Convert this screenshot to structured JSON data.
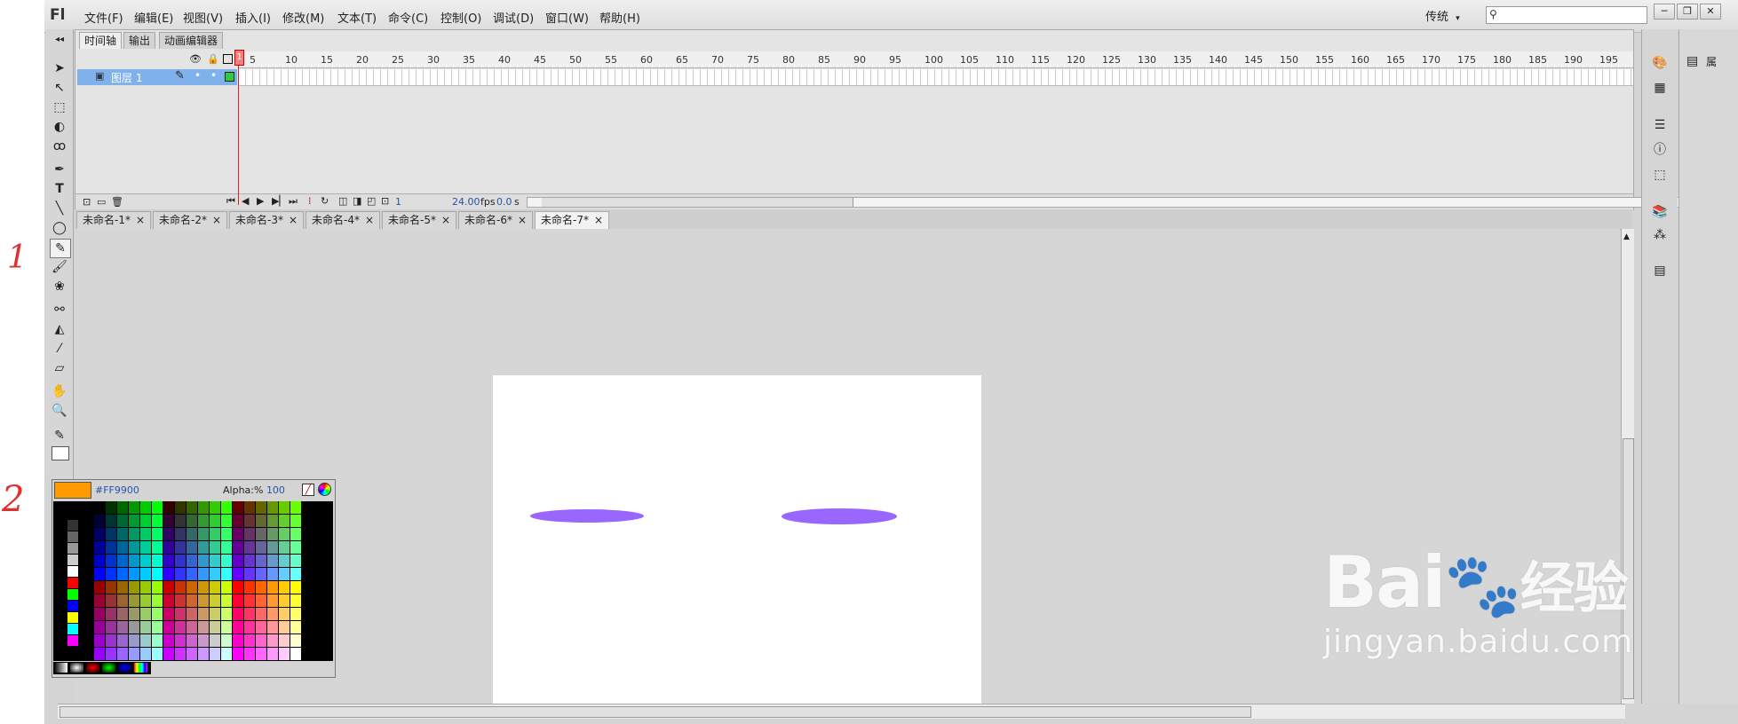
{
  "app": {
    "logo": "Fl"
  },
  "menu": [
    "文件(F)",
    "编辑(E)",
    "视图(V)",
    "插入(I)",
    "修改(M)",
    "文本(T)",
    "命令(C)",
    "控制(O)",
    "调试(D)",
    "窗口(W)",
    "帮助(H)"
  ],
  "workspace": {
    "label": "传统",
    "arrow": "▾"
  },
  "window_controls": [
    "─",
    "❐",
    "✕"
  ],
  "timeline": {
    "tabs": [
      "时间轴",
      "输出",
      "动画编辑器"
    ],
    "frame_numbers": [
      "5",
      "10",
      "15",
      "20",
      "25",
      "30",
      "35",
      "40",
      "45",
      "50",
      "55",
      "60",
      "65",
      "70",
      "75",
      "80",
      "85",
      "90",
      "95",
      "100",
      "105",
      "110",
      "115",
      "120",
      "125",
      "130",
      "135",
      "140",
      "145",
      "150",
      "155",
      "160",
      "165",
      "170",
      "175",
      "180",
      "185",
      "190",
      "195"
    ],
    "current_frame_marker": "1",
    "layer": {
      "name": "图层 1"
    },
    "status": {
      "frame": "1",
      "fps": "24.00",
      "fps_unit": "fps",
      "time": "0.0",
      "time_unit": "s"
    }
  },
  "doc_tabs": [
    "未命名-1*",
    "未命名-2*",
    "未命名-3*",
    "未命名-4*",
    "未命名-5*",
    "未命名-6*",
    "未命名-7*"
  ],
  "active_doc_tab": 6,
  "tab_close": "×",
  "color_popup": {
    "hex": "#FF9900",
    "alpha_label": "Alpha:%",
    "alpha_value": "100"
  },
  "colors": {
    "fill_swatch": "#ff9900",
    "eye": "#9966ff",
    "stage": "#ffffff",
    "layer_highlight": "#7fb2ea"
  },
  "annotations": [
    "1",
    "2"
  ],
  "watermark": {
    "brand": "Bai",
    "brand_suffix": "经验",
    "url": "jingyan.baidu.com"
  },
  "right_panel_label": "属"
}
